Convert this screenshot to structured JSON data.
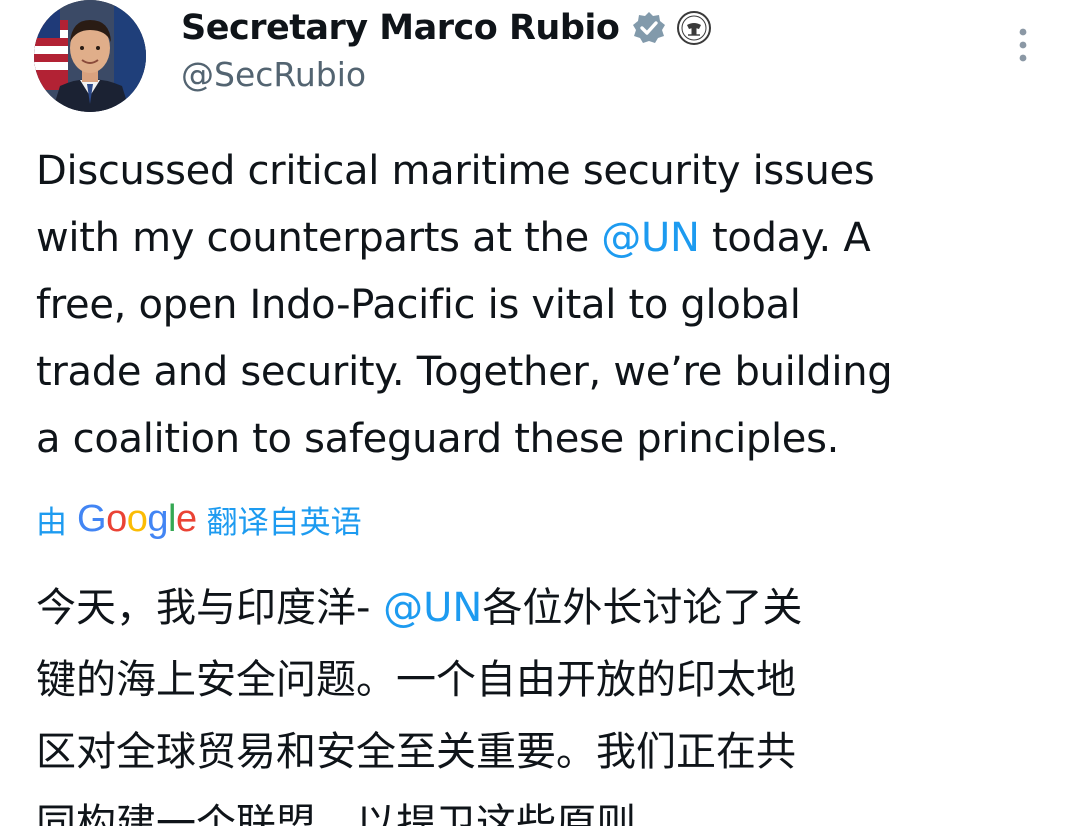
{
  "author": {
    "display_name": "Secretary Marco Rubio",
    "handle": "@SecRubio",
    "verified_badge_icon": "verified-badge-icon",
    "affiliation_icon": "state-department-seal-icon",
    "avatar_icon": "profile-photo"
  },
  "more_menu_icon": "more-vertical-icon",
  "tweet": {
    "lines": [
      {
        "before": "Discussed critical maritime security issues",
        "mention": "",
        "after": ""
      },
      {
        "before": "with my counterparts at the ",
        "mention": "@UN",
        "after": " today. A"
      },
      {
        "before": "free, open Indo-Pacific is vital to global",
        "mention": "",
        "after": ""
      },
      {
        "before": "trade and security. Together, we’re building",
        "mention": "",
        "after": ""
      },
      {
        "before": "a coalition to safeguard these principles.",
        "mention": "",
        "after": ""
      }
    ]
  },
  "translation_notice": {
    "prefix": "由",
    "brand_letters": [
      "G",
      "o",
      "o",
      "g",
      "l",
      "e"
    ],
    "suffix": "翻译自英语"
  },
  "translation": {
    "lines": [
      {
        "before": "今天，我与印度洋- ",
        "mention": "@UN",
        "after": "各位外长讨论了关"
      },
      {
        "before": "键的海上安全问题。一个自由开放的印太地",
        "mention": "",
        "after": ""
      },
      {
        "before": "区对全球贸易和安全至关重要。我们正在共",
        "mention": "",
        "after": ""
      },
      {
        "before": "同构建一个联盟，以捍卫这些原则。",
        "mention": "",
        "after": ""
      }
    ]
  },
  "colors": {
    "link": "#1d9bf0",
    "text": "#0f1419",
    "secondary": "#536471"
  }
}
